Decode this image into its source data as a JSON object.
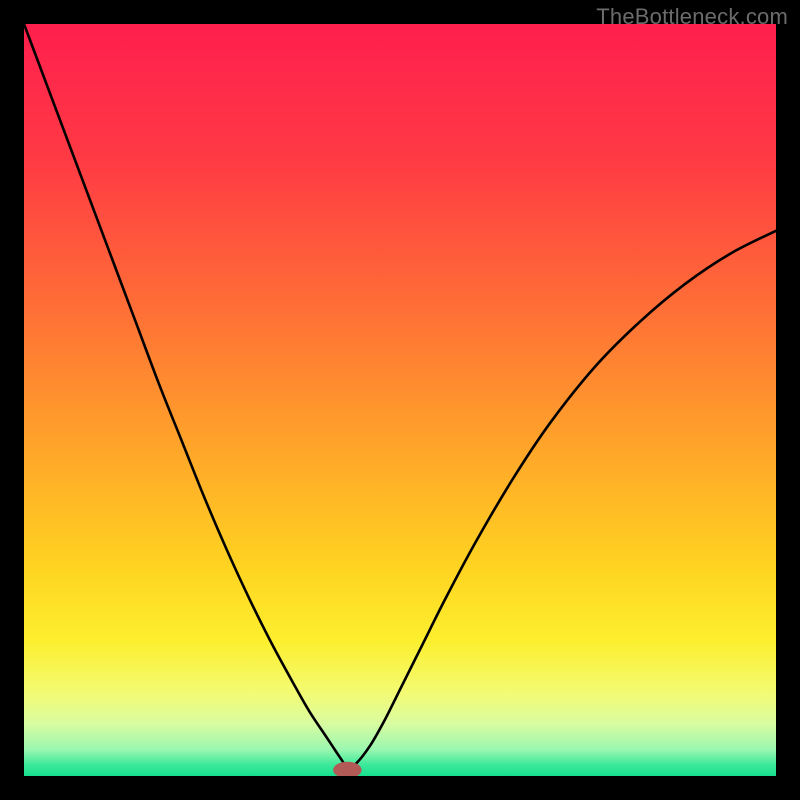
{
  "watermark": "TheBottleneck.com",
  "chart_data": {
    "type": "line",
    "title": "",
    "xlabel": "",
    "ylabel": "",
    "xlim": [
      0,
      100
    ],
    "ylim": [
      0,
      100
    ],
    "background_gradient_stops": [
      {
        "offset": 0.0,
        "color": "#ff1f4e"
      },
      {
        "offset": 0.18,
        "color": "#ff3a44"
      },
      {
        "offset": 0.38,
        "color": "#ff6f36"
      },
      {
        "offset": 0.55,
        "color": "#ffa12a"
      },
      {
        "offset": 0.72,
        "color": "#ffd321"
      },
      {
        "offset": 0.82,
        "color": "#fcef2e"
      },
      {
        "offset": 0.89,
        "color": "#f3fb74"
      },
      {
        "offset": 0.93,
        "color": "#d9fca0"
      },
      {
        "offset": 0.965,
        "color": "#9af7b0"
      },
      {
        "offset": 0.985,
        "color": "#3de99b"
      },
      {
        "offset": 1.0,
        "color": "#16df8e"
      }
    ],
    "series": [
      {
        "name": "bottleneck-curve",
        "stroke": "#000000",
        "x": [
          0,
          3,
          6,
          9,
          12,
          15,
          18,
          21,
          24,
          27,
          30,
          33,
          36,
          38,
          40,
          41,
          42,
          43,
          44,
          46,
          48,
          50,
          53,
          56,
          60,
          65,
          70,
          76,
          82,
          88,
          94,
          100
        ],
        "y": [
          100,
          92,
          84,
          76,
          68,
          60,
          52,
          44.5,
          37,
          30,
          23.5,
          17.5,
          12,
          8.5,
          5.5,
          4,
          2.5,
          1.2,
          1.5,
          4,
          7.5,
          11.5,
          17.5,
          23.5,
          31,
          39.5,
          47,
          54.5,
          60.5,
          65.5,
          69.5,
          72.5
        ]
      }
    ],
    "marker": {
      "name": "optimal-point",
      "x": 43,
      "y": 0.8,
      "rx": 1.9,
      "ry": 1.1,
      "fill": "#b25a56"
    }
  }
}
